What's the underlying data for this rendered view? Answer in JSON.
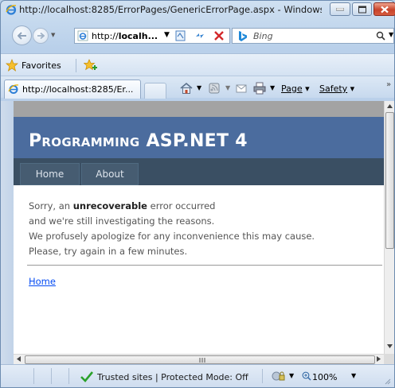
{
  "window": {
    "title": "http://localhost:8285/ErrorPages/GenericErrorPage.aspx - Windows Int..."
  },
  "navbar": {
    "address_prefix": "http://",
    "address_host": "localh...",
    "search_placeholder": "Bing"
  },
  "favorites_bar": {
    "favorites_label": "Favorites"
  },
  "tab": {
    "label": "http://localhost:8285/Er..."
  },
  "command_bar": {
    "page_label": "Page",
    "safety_label": "Safety",
    "more": "»"
  },
  "page": {
    "site_title": "Programming ASP.NET 4",
    "menu": [
      {
        "label": "Home"
      },
      {
        "label": "About"
      }
    ],
    "message_prefix": "Sorry, an ",
    "message_bold": "unrecoverable",
    "message_suffix": " error occurred",
    "lines": [
      "and we're still investigating the reasons.",
      "We profusely apologize for any inconvenience this may cause.",
      "Please, try again in a few minutes."
    ],
    "home_link": "Home"
  },
  "status_bar": {
    "security_text": "Trusted sites | Protected Mode: Off",
    "zoom": "100%"
  },
  "colors": {
    "header_bg": "#4b6c9e",
    "menu_bg": "#3a4f63",
    "menu_item_bg": "#465c71",
    "link": "#034af3"
  }
}
